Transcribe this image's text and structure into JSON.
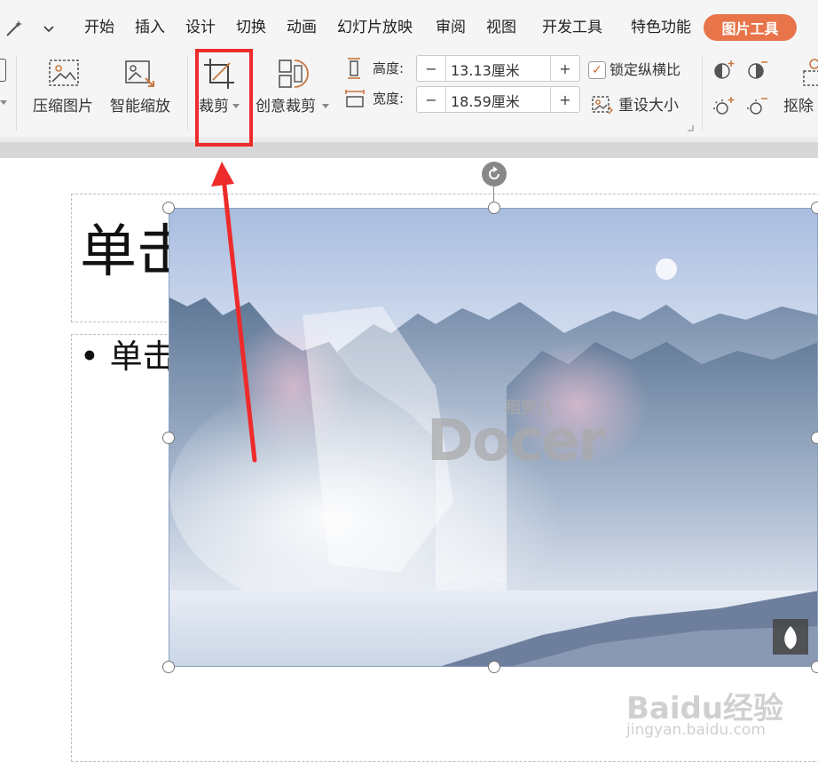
{
  "menubar": {
    "items": [
      "开始",
      "插入",
      "设计",
      "切换",
      "动画",
      "幻灯片放映",
      "审阅",
      "视图",
      "开发工具",
      "特色功能"
    ],
    "active_tab": "图片工具",
    "accent_color": "#e8744a"
  },
  "ribbon": {
    "compress_label": "压缩图片",
    "smart_zoom_label": "智能缩放",
    "crop_label": "裁剪",
    "creative_crop_label": "创意裁剪",
    "height_label": "高度:",
    "height_value": "13.13厘米",
    "width_label": "宽度:",
    "width_value": "18.59厘米",
    "lock_ratio_label": "锁定纵横比",
    "lock_ratio_checked": true,
    "reset_size_label": "重设大小",
    "remove_bg_label": "抠除",
    "minus_glyph": "−",
    "plus_glyph": "+"
  },
  "slide": {
    "title_text": "单击",
    "bullet_text": "单击"
  },
  "picture": {
    "watermark_brand": "Docer",
    "watermark_cn": "稻壳儿"
  },
  "watermark": {
    "site_text": "Baidu经验",
    "url_text": "jingyan.baidu.com"
  },
  "annotation": {
    "highlight_color": "#ee2b2b"
  }
}
